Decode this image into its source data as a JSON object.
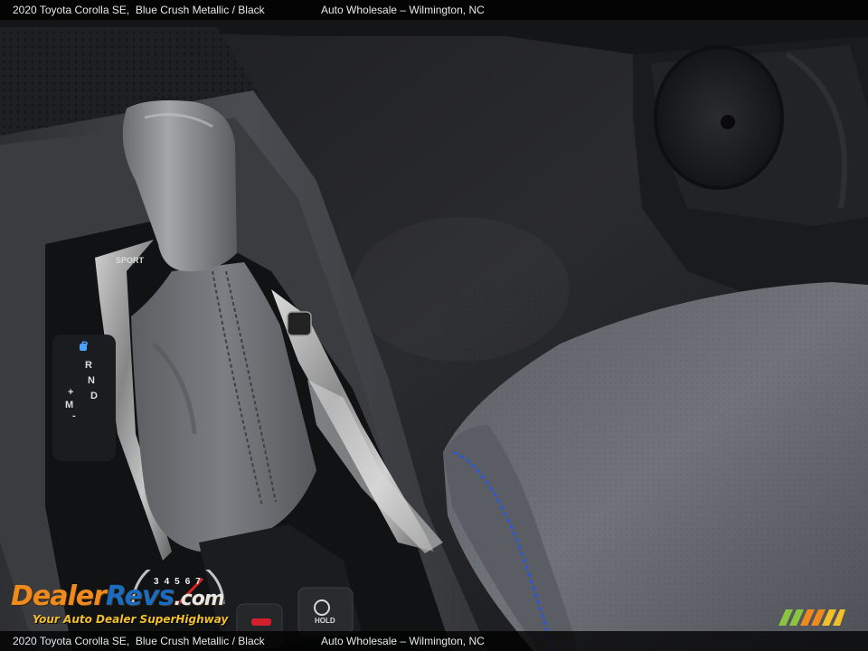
{
  "caption": {
    "vehicle": "2020 Toyota Corolla SE,",
    "color": "Blue Crush Metallic",
    "separator": "/",
    "interior": "Black",
    "dealer": "Auto Wholesale",
    "dash": "–",
    "location": "Wilmington, NC"
  },
  "shifter_labels": {
    "sport": "SPORT",
    "gears": [
      "P",
      "R",
      "N",
      "D"
    ],
    "manual_plus": "+",
    "manual_m": "M",
    "manual_minus": "-",
    "hold": "HOLD"
  },
  "watermark": {
    "brand_part1": "Dealer",
    "brand_part2": "Revs",
    "brand_suffix": ".com",
    "tagline": "Your Auto Dealer SuperHighway",
    "gauge_digits": [
      "3",
      "4",
      "5",
      "6",
      "7"
    ]
  },
  "colors": {
    "accent_orange": "#f08a1c",
    "accent_blue": "#1b6cc1",
    "seat_stitch_blue": "#2a58d8"
  }
}
